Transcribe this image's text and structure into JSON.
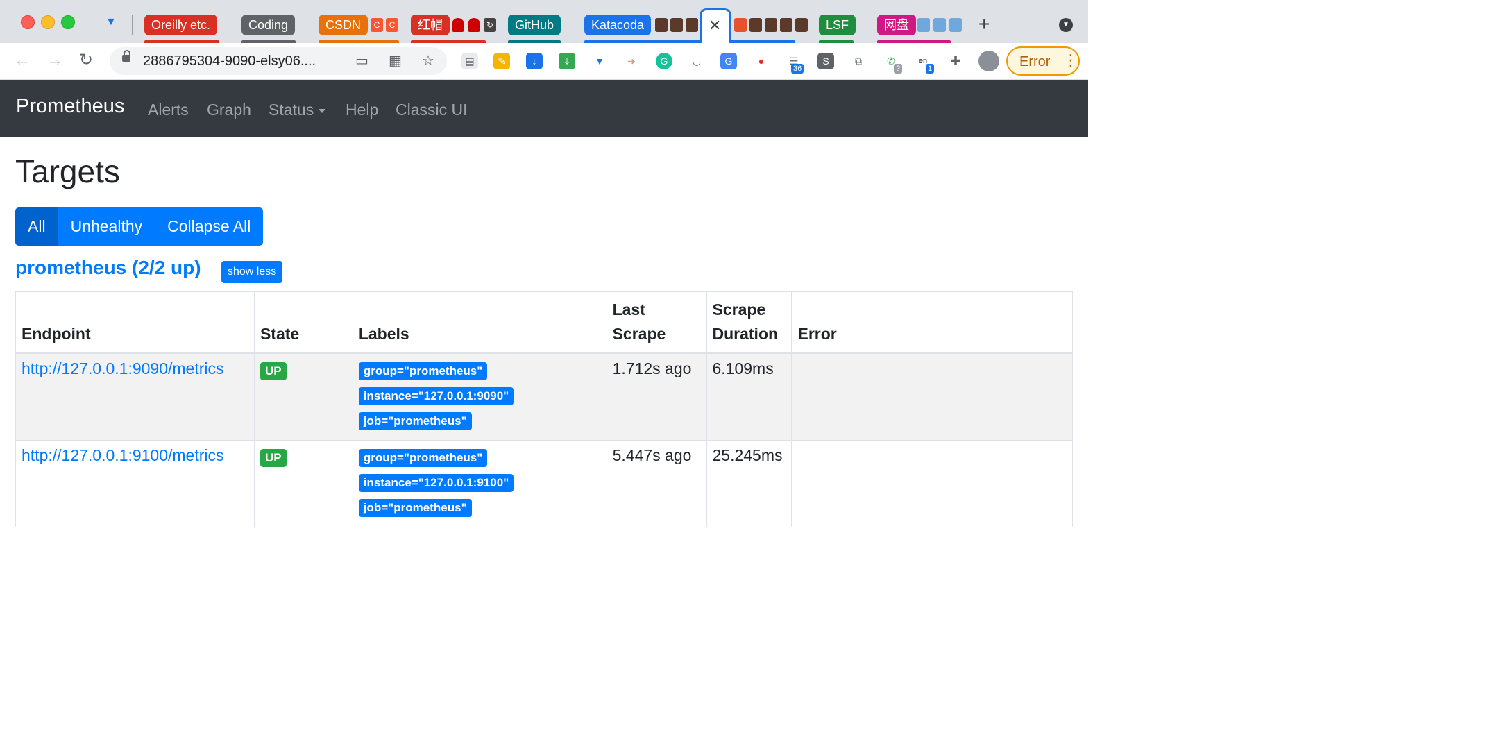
{
  "browser": {
    "tab_groups": [
      {
        "label": "Oreilly etc.",
        "color": "#d93025"
      },
      {
        "label": "Coding",
        "color": "#5f6368"
      },
      {
        "label": "CSDN",
        "color": "#e8710a"
      },
      {
        "label": "红帽",
        "color": "#d93025"
      },
      {
        "label": "GitHub",
        "color": "#007b83"
      },
      {
        "label": "Katacoda",
        "color": "#1a73e8"
      },
      {
        "label": "LSF",
        "color": "#1e8e3e"
      },
      {
        "label": "网盘",
        "color": "#d01884"
      }
    ],
    "active_tab_close": "✕",
    "new_tab": "+",
    "address": "2886795304-9090-elsy06....",
    "extension_badges": {
      "counter": "36",
      "lang": "1",
      "lang_text": "en",
      "help": "?"
    },
    "profile_error": "Error"
  },
  "navbar": {
    "brand": "Prometheus",
    "links": [
      "Alerts",
      "Graph",
      "Status",
      "Help",
      "Classic UI"
    ]
  },
  "page": {
    "title": "Targets",
    "filter_buttons": [
      "All",
      "Unhealthy",
      "Collapse All"
    ],
    "pool_title": "prometheus (2/2 up)",
    "show_less": "show less"
  },
  "table": {
    "headers": {
      "endpoint": "Endpoint",
      "state": "State",
      "labels": "Labels",
      "last_scrape_1": "Last",
      "last_scrape_2": "Scrape",
      "scrape_duration_1": "Scrape",
      "scrape_duration_2": "Duration",
      "error": "Error"
    },
    "rows": [
      {
        "endpoint": "http://127.0.0.1:9090/metrics",
        "state": "UP",
        "labels": [
          "group=\"prometheus\"",
          "instance=\"127.0.0.1:9090\"",
          "job=\"prometheus\""
        ],
        "last_scrape": "1.712s ago",
        "scrape_duration": "6.109ms",
        "error": ""
      },
      {
        "endpoint": "http://127.0.0.1:9100/metrics",
        "state": "UP",
        "labels": [
          "group=\"prometheus\"",
          "instance=\"127.0.0.1:9100\"",
          "job=\"prometheus\""
        ],
        "last_scrape": "5.447s ago",
        "scrape_duration": "25.245ms",
        "error": ""
      }
    ]
  },
  "colors": {
    "navbar_bg": "#343a40",
    "primary": "#007bff",
    "success": "#28a745",
    "error_pill": "#f29900"
  }
}
